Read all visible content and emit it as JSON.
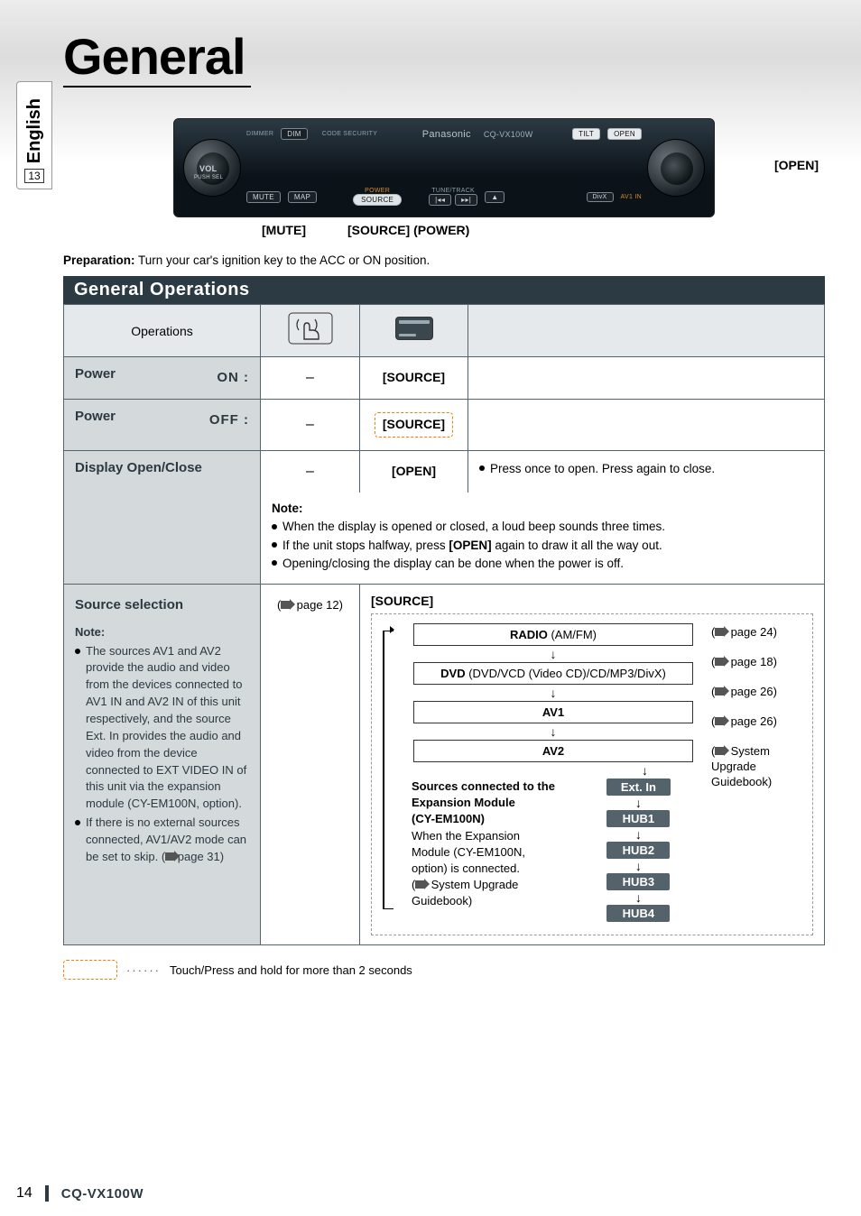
{
  "lang": {
    "label": "English",
    "page_index": "13"
  },
  "chapter_title": "General",
  "device": {
    "labels": {
      "vol": "[VOL]",
      "tilt": "[TILT]",
      "open": "[OPEN]",
      "mute": "[MUTE]",
      "source_power": "[SOURCE] (POWER)"
    },
    "print": {
      "dimmer": "DIMMER",
      "dim": "DIM",
      "code": "CODE SECURITY",
      "brand": "Panasonic",
      "model": "CQ-VX100W",
      "tilt": "TILT",
      "open": "OPEN",
      "vol": "VOL",
      "pushsel": "PUSH SEL",
      "mute": "MUTE",
      "map": "MAP",
      "power": "POWER",
      "source": "SOURCE",
      "tune": "TUNE/TRACK",
      "divx": "DivX",
      "av1in": "AV1 IN"
    }
  },
  "preparation": {
    "label": "Preparation:",
    "text": " Turn your car's ignition key to the ACC or ON position."
  },
  "section_title": "General Operations",
  "table": {
    "head_operations": "Operations",
    "power_on": {
      "label": "Power",
      "state": "ON :",
      "hand": "–",
      "remote": "[SOURCE]"
    },
    "power_off": {
      "label": "Power",
      "state": "OFF :",
      "hand": "–",
      "remote": "[SOURCE]"
    },
    "display": {
      "label": "Display Open/Close",
      "hand": "–",
      "remote": "[OPEN]",
      "desc_bullet": "Press once to open. Press again to close.",
      "note_label": "Note:",
      "note_1": "When the display is opened or closed, a loud beep sounds three times.",
      "note_2_a": "If the unit stops halfway, press ",
      "note_2_b": "[OPEN]",
      "note_2_c": " again to draw it all the way out.",
      "note_3": "Opening/closing the display can be done when the power is off."
    },
    "source": {
      "title": "Source selection",
      "hand_ref": "page 12)",
      "remote": "[SOURCE]",
      "note_label": "Note:",
      "bullet1": "The sources AV1 and AV2 provide the audio and video from the devices connected to AV1 IN and AV2 IN of this unit respectively, and the source Ext. In provides the audio and video from the device connected to EXT VIDEO IN of this unit via the expansion module (CY-EM100N, option).",
      "bullet2_a": "If there is no external sources connected, AV1/AV2 mode can be set to skip. (",
      "bullet2_b": " page 31)",
      "flow": {
        "radio_b": "RADIO",
        "radio_t": " (AM/FM)",
        "dvd_b": "DVD",
        "dvd_t": " (DVD/VCD (Video CD)/CD/MP3/DivX)",
        "av1": "AV1",
        "av2": "AV2",
        "extin": "Ext. In",
        "hub1": "HUB1",
        "hub2": "HUB2",
        "hub3": "HUB3",
        "hub4": "HUB4",
        "expand_b1": "Sources connected to the Expansion Module",
        "expand_b2": "(CY-EM100N)",
        "expand_t1": "When the Expansion Module (CY-EM100N, option) is connected.",
        "expand_t2": "System Upgrade Guidebook)",
        "page_radio": "page 24)",
        "page_dvd": "page 18)",
        "page_av1": "page 26)",
        "page_av2": "page 26)",
        "sysref": "System Upgrade Guidebook)"
      }
    }
  },
  "legend": "Touch/Press and hold for more than 2 seconds",
  "footer": {
    "page": "14",
    "model": "CQ-VX100W"
  }
}
